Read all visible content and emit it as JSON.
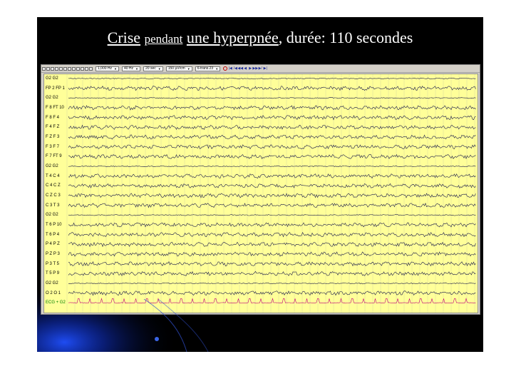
{
  "slide": {
    "background": "#000000",
    "title": {
      "part1": "Crise",
      "part2": "pendant",
      "part3": "une hyperpnée",
      "part4": ", durée: 110 secondes"
    }
  },
  "toolbar": {
    "icons": [
      "open-icon",
      "save-icon",
      "print-icon",
      "cut-icon",
      "copy-icon",
      "paste-icon",
      "montage-icon",
      "filter-icon",
      "zoom-icon",
      "marker-icon",
      "grid-icon",
      "settings-icon"
    ],
    "selects": [
      {
        "name": "low-filter-select",
        "value": "1,000 Hz"
      },
      {
        "name": "high-filter-select",
        "value": "40 Hz"
      },
      {
        "name": "time-base-select",
        "value": "20 sec"
      },
      {
        "name": "sensitivity-select",
        "value": "150 µV/cm"
      },
      {
        "name": "montage-select",
        "value": "6-trans.23"
      }
    ],
    "nav": [
      "|◀",
      "/◀",
      "◀◀",
      "◀",
      "▶",
      "▶▶",
      "▶/",
      "▶|"
    ]
  },
  "eeg": {
    "background": "#ffff99",
    "trace_color": "#1a1a4a",
    "ecg_color": "#c0007a",
    "channels": [
      "G2 G2",
      "FP 2 FP 1",
      "G2 G2",
      "F 8 FT 10",
      "F 8 F 4",
      "F 4 F Z",
      "F Z F 3",
      "F 3 F 7",
      "F 7 FT 9",
      "G2 G2",
      "T 4 C 4",
      "C 4 C Z",
      "C Z C 3",
      "C 3 T 3",
      "G2 G2",
      "T 6 P 10",
      "T 6 P 4",
      "P 4 P Z",
      "P Z P 3",
      "P 3 T 5",
      "T 5 P 9",
      "G2 G2",
      "O 2 O 1",
      "ECG + G2"
    ]
  }
}
